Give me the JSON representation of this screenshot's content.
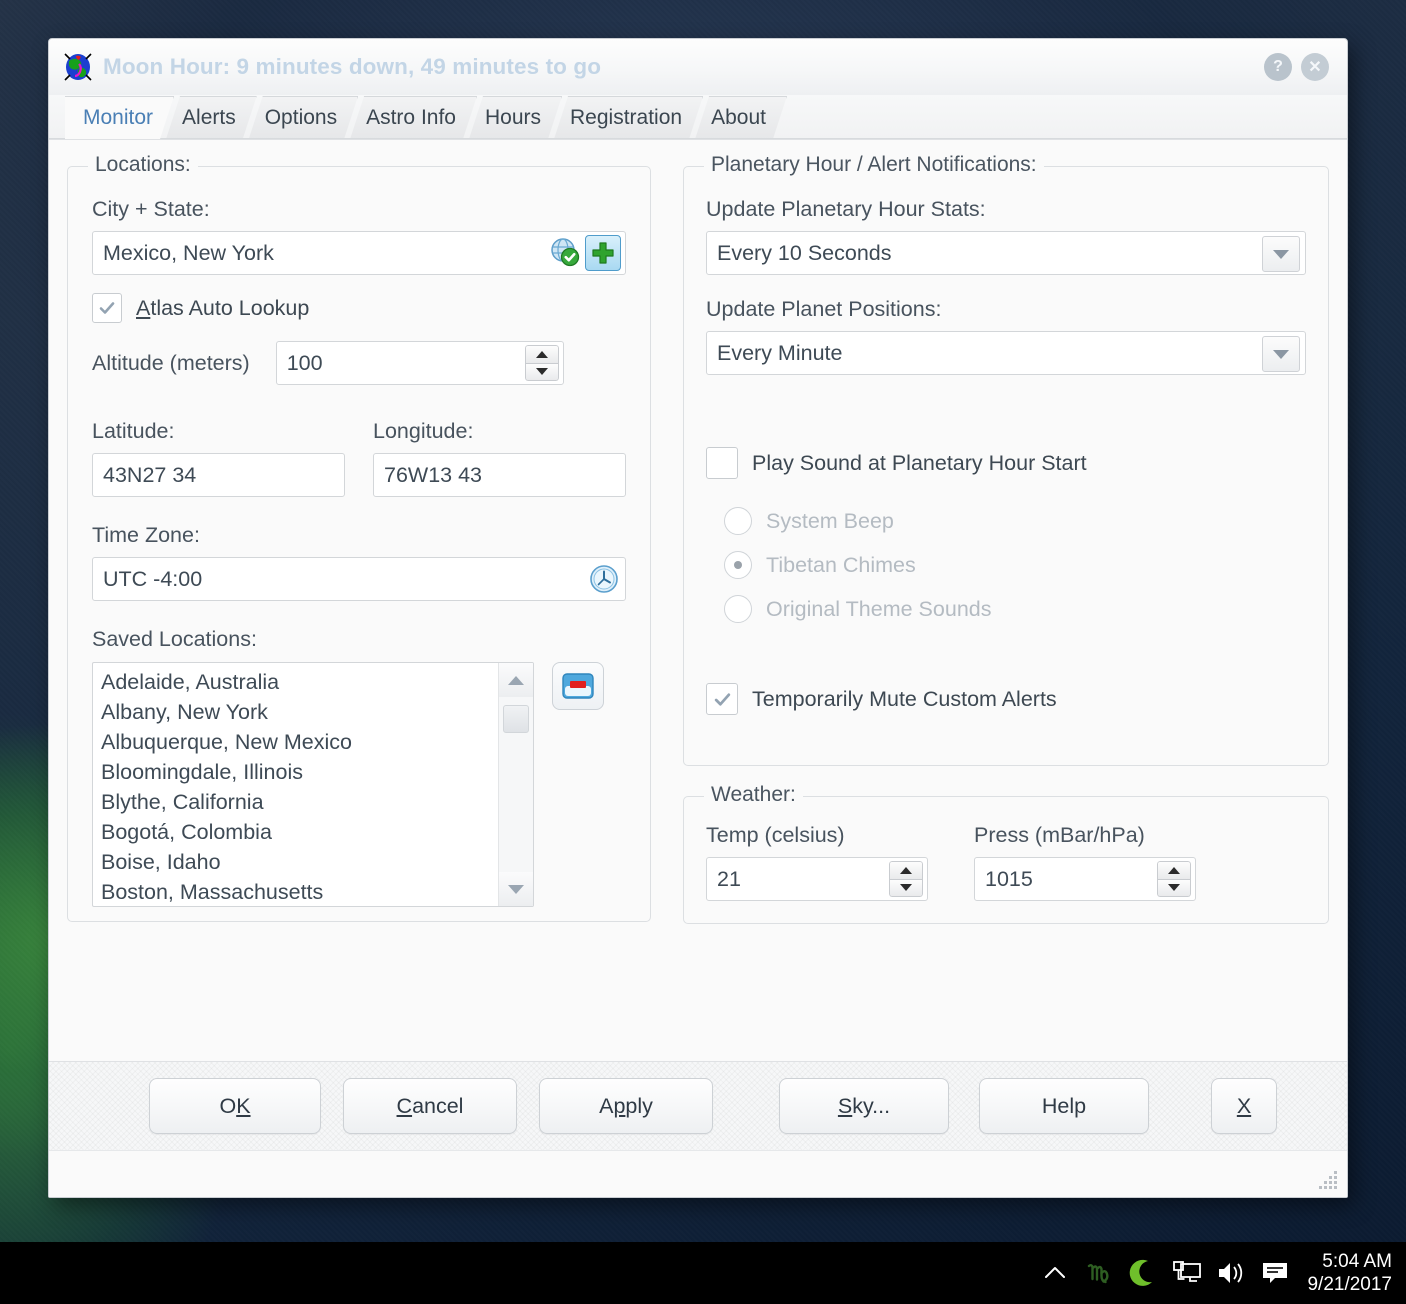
{
  "window": {
    "title": "Moon Hour: 9 minutes down, 49 minutes to go",
    "help_button": "?",
    "close_button": "✕"
  },
  "tabs": [
    {
      "label": "Monitor",
      "active": true
    },
    {
      "label": "Alerts",
      "active": false
    },
    {
      "label": "Options",
      "active": false
    },
    {
      "label": "Astro Info",
      "active": false
    },
    {
      "label": "Hours",
      "active": false
    },
    {
      "label": "Registration",
      "active": false
    },
    {
      "label": "About",
      "active": false
    }
  ],
  "locations": {
    "group_label": "Locations:",
    "city_label": "City + State:",
    "city_value": "Mexico, New York",
    "lookup_icon": "globe-check-icon",
    "add_icon": "green-plus-icon",
    "atlas_checkbox": {
      "label_prefix": "",
      "label_accel": "A",
      "label_rest": "tlas Auto Lookup",
      "checked": true
    },
    "altitude_label": "Altitude (meters)",
    "altitude_value": "100",
    "latitude_label": "Latitude:",
    "latitude_value": "43N27 34",
    "longitude_label": "Longitude:",
    "longitude_value": "76W13 43",
    "timezone_label": "Time Zone:",
    "timezone_value": "UTC -4:00",
    "timezone_icon": "clock-icon",
    "saved_label": "Saved Locations:",
    "saved_items": [
      "Adelaide, Australia",
      "Albany, New York",
      "Albuquerque, New Mexico",
      "Bloomingdale, Illinois",
      "Blythe, California",
      "Bogotá, Colombia",
      "Boise, Idaho",
      "Boston, Massachusetts"
    ],
    "remove_icon": "red-minus-icon"
  },
  "notifications": {
    "group_label": "Planetary Hour / Alert Notifications:",
    "stats_label": "Update Planetary Hour Stats:",
    "stats_value": "Every 10 Seconds",
    "positions_label": "Update Planet Positions:",
    "positions_value": "Every Minute",
    "play_sound": {
      "label": "Play Sound at Planetary Hour Start",
      "checked": false
    },
    "sound_options": [
      {
        "label": "System Beep",
        "selected": false,
        "disabled": true
      },
      {
        "label": "Tibetan Chimes",
        "selected": true,
        "disabled": true
      },
      {
        "label": "Original Theme Sounds",
        "selected": false,
        "disabled": true
      }
    ],
    "mute": {
      "label": "Temporarily Mute Custom Alerts",
      "checked": true
    }
  },
  "weather": {
    "group_label": "Weather:",
    "temp_label": "Temp (celsius)",
    "temp_value": "21",
    "press_label": "Press (mBar/hPa)",
    "press_value": "1015"
  },
  "footer_buttons": [
    {
      "name": "ok-button",
      "pre": "O",
      "accel": "K",
      "post": ""
    },
    {
      "name": "cancel-button",
      "pre": "",
      "accel": "C",
      "post": "ancel"
    },
    {
      "name": "apply-button",
      "pre": "A",
      "accel": "p",
      "post": "ply"
    },
    {
      "name": "sky-button",
      "pre": "",
      "accel": "S",
      "post": "ky..."
    },
    {
      "name": "help-button",
      "pre": "Help",
      "accel": "",
      "post": ""
    },
    {
      "name": "x-button",
      "pre": "",
      "accel": "X",
      "post": ""
    }
  ],
  "taskbar": {
    "tray_icons": [
      "chevron-up-icon",
      "virgo-glyph-icon",
      "crescent-moon-icon",
      "network-monitor-icon",
      "speaker-icon",
      "action-center-icon"
    ],
    "time": "5:04 AM",
    "date": "9/21/2017"
  },
  "colors": {
    "accent_tab": "#4a7fb5",
    "title_text": "#c3d5e6",
    "desktop": "#0d2035",
    "green_plus": "#3aa935",
    "red_minus": "#e02020",
    "moon_green": "#6bbf2a"
  }
}
